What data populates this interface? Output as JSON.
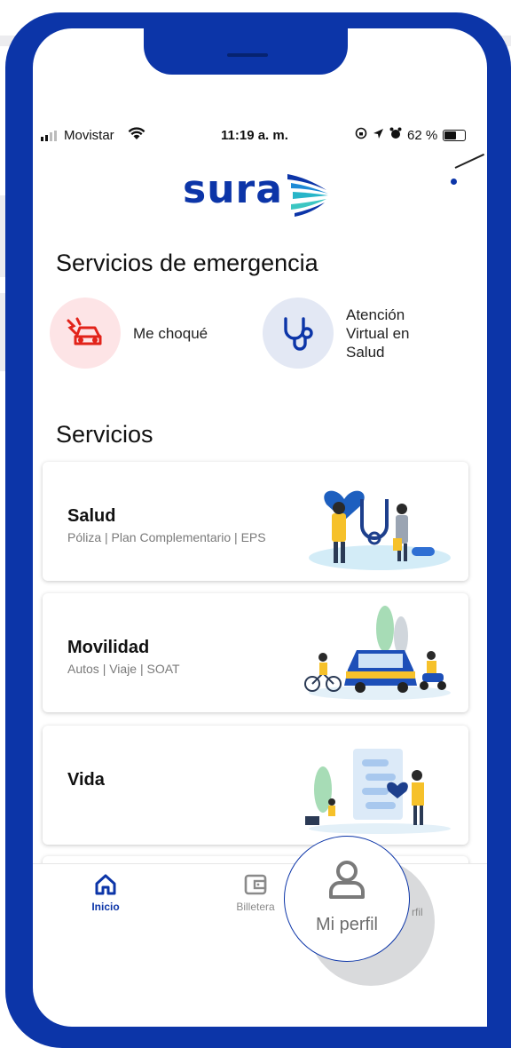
{
  "status_bar": {
    "carrier": "Movistar",
    "time": "11:19 a. m.",
    "battery": "62 %",
    "battery_level": 0.62
  },
  "brand": {
    "logo_text": "sura",
    "color": "#0c35a8"
  },
  "emergency": {
    "title": "Servicios de emergencia",
    "items": [
      {
        "label": "Me choqué",
        "icon": "car-crash-icon",
        "bg": "#fde4e6",
        "accent": "#e2231a"
      },
      {
        "label_lines": [
          "Atención",
          "Virtual en",
          "Salud"
        ],
        "icon": "stethoscope-icon",
        "bg": "#e3e8f4",
        "accent": "#0c35a8"
      }
    ]
  },
  "services": {
    "title": "Servicios",
    "cards": [
      {
        "title": "Salud",
        "subtitle": "Póliza | Plan Complementario | EPS",
        "illustration": "health-illustration"
      },
      {
        "title": "Movilidad",
        "subtitle": "Autos | Viaje | SOAT",
        "illustration": "mobility-illustration"
      },
      {
        "title": "Vida",
        "subtitle": "",
        "illustration": "life-illustration"
      }
    ]
  },
  "bottom_nav": {
    "items": [
      {
        "label": "Inicio",
        "icon": "home-icon",
        "active": true
      },
      {
        "label": "Billetera",
        "icon": "wallet-icon",
        "active": false
      }
    ],
    "partial_label": "rfil",
    "callout": {
      "label": "Mi perfil",
      "icon": "user-icon"
    }
  }
}
